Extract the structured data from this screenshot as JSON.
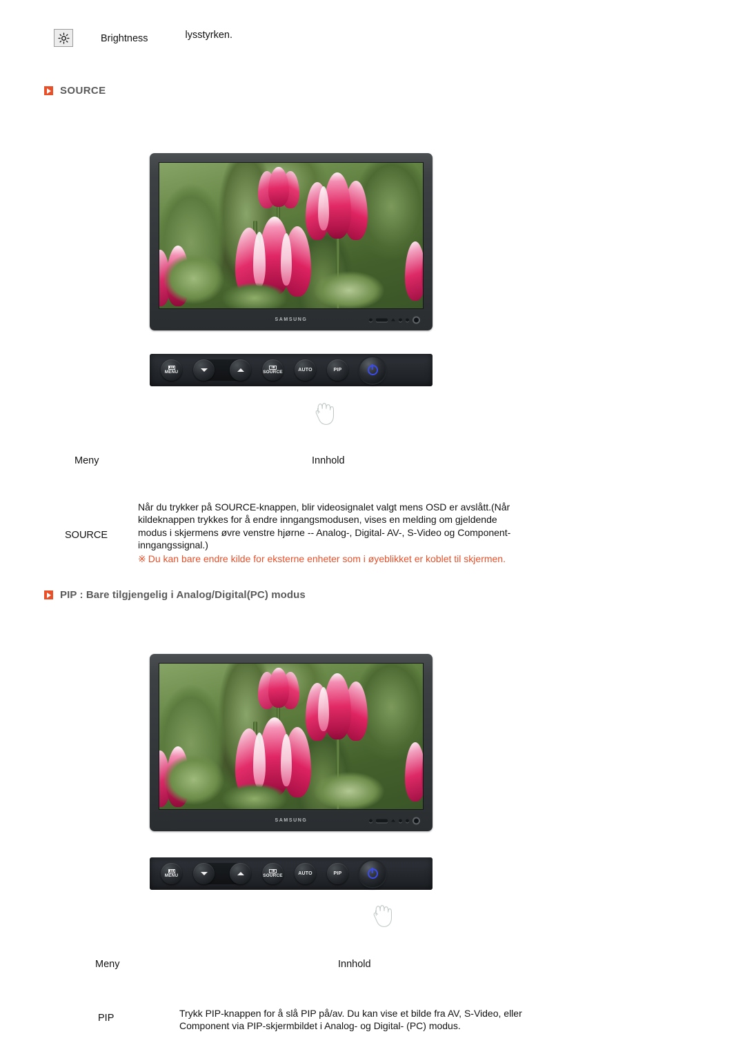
{
  "page": {
    "brightness_row": {
      "icon": "brightness-sun-icon",
      "label": "Brightness",
      "description": "lysstyrken."
    },
    "sections": [
      {
        "id": "source",
        "heading": "SOURCE",
        "bullet_color": "#e8502a",
        "heading_color": "#5a5a5a",
        "monitor": {
          "brand": "SAMSUNG",
          "screen_content": "pink-tulips-photo"
        },
        "control_buttons": [
          {
            "name": "menu",
            "label": "MENU",
            "glyph": "osd-menu-icon"
          },
          {
            "name": "down",
            "label": "",
            "glyph": "triangle-down-icon"
          },
          {
            "name": "up",
            "label": "",
            "glyph": "triangle-up-brightness-icon"
          },
          {
            "name": "source",
            "label": "SOURCE",
            "glyph": "source-input-icon"
          },
          {
            "name": "auto",
            "label": "AUTO",
            "glyph": ""
          },
          {
            "name": "pip",
            "label": "PIP",
            "glyph": ""
          },
          {
            "name": "power",
            "label": "",
            "glyph": "power-icon"
          }
        ],
        "table": {
          "col1_header": "Meny",
          "col2_header": "Innhold",
          "rows": [
            {
              "menu": "SOURCE",
              "content": "Når du trykker på SOURCE-knappen, blir videosignalet valgt mens OSD er avslått.(Når kildeknappen trykkes for å endre inngangsmodusen, vises en melding om gjeldende modus i skjermens øvre venstre hjørne -- Analog-, Digital- AV-, S-Video og Component-inngangssignal.)",
              "warning_mark": "※",
              "warning": "Du kan bare endre kilde for eksterne enheter som i øyeblikket er koblet til skjermen.",
              "warning_color": "#e8502a"
            }
          ]
        }
      },
      {
        "id": "pip",
        "heading": "PIP : Bare tilgjengelig i Analog/Digital(PC) modus",
        "bullet_color": "#e8502a",
        "heading_color": "#5a5a5a",
        "monitor": {
          "brand": "SAMSUNG",
          "screen_content": "pink-tulips-photo"
        },
        "control_buttons": [
          {
            "name": "menu",
            "label": "MENU",
            "glyph": "osd-menu-icon"
          },
          {
            "name": "down",
            "label": "",
            "glyph": "triangle-down-icon"
          },
          {
            "name": "up",
            "label": "",
            "glyph": "triangle-up-brightness-icon"
          },
          {
            "name": "source",
            "label": "SOURCE",
            "glyph": "source-input-icon"
          },
          {
            "name": "auto",
            "label": "AUTO",
            "glyph": ""
          },
          {
            "name": "pip",
            "label": "PIP",
            "glyph": ""
          },
          {
            "name": "power",
            "label": "",
            "glyph": "power-icon"
          }
        ],
        "table": {
          "col1_header": "Meny",
          "col2_header": "Innhold",
          "rows": [
            {
              "menu": "PIP",
              "content": "Trykk PIP-knappen for å slå PIP på/av. Du kan vise et bilde fra AV, S-Video, eller Component via PIP-skjermbildet i Analog- og Digital- (PC) modus."
            }
          ]
        }
      }
    ]
  }
}
